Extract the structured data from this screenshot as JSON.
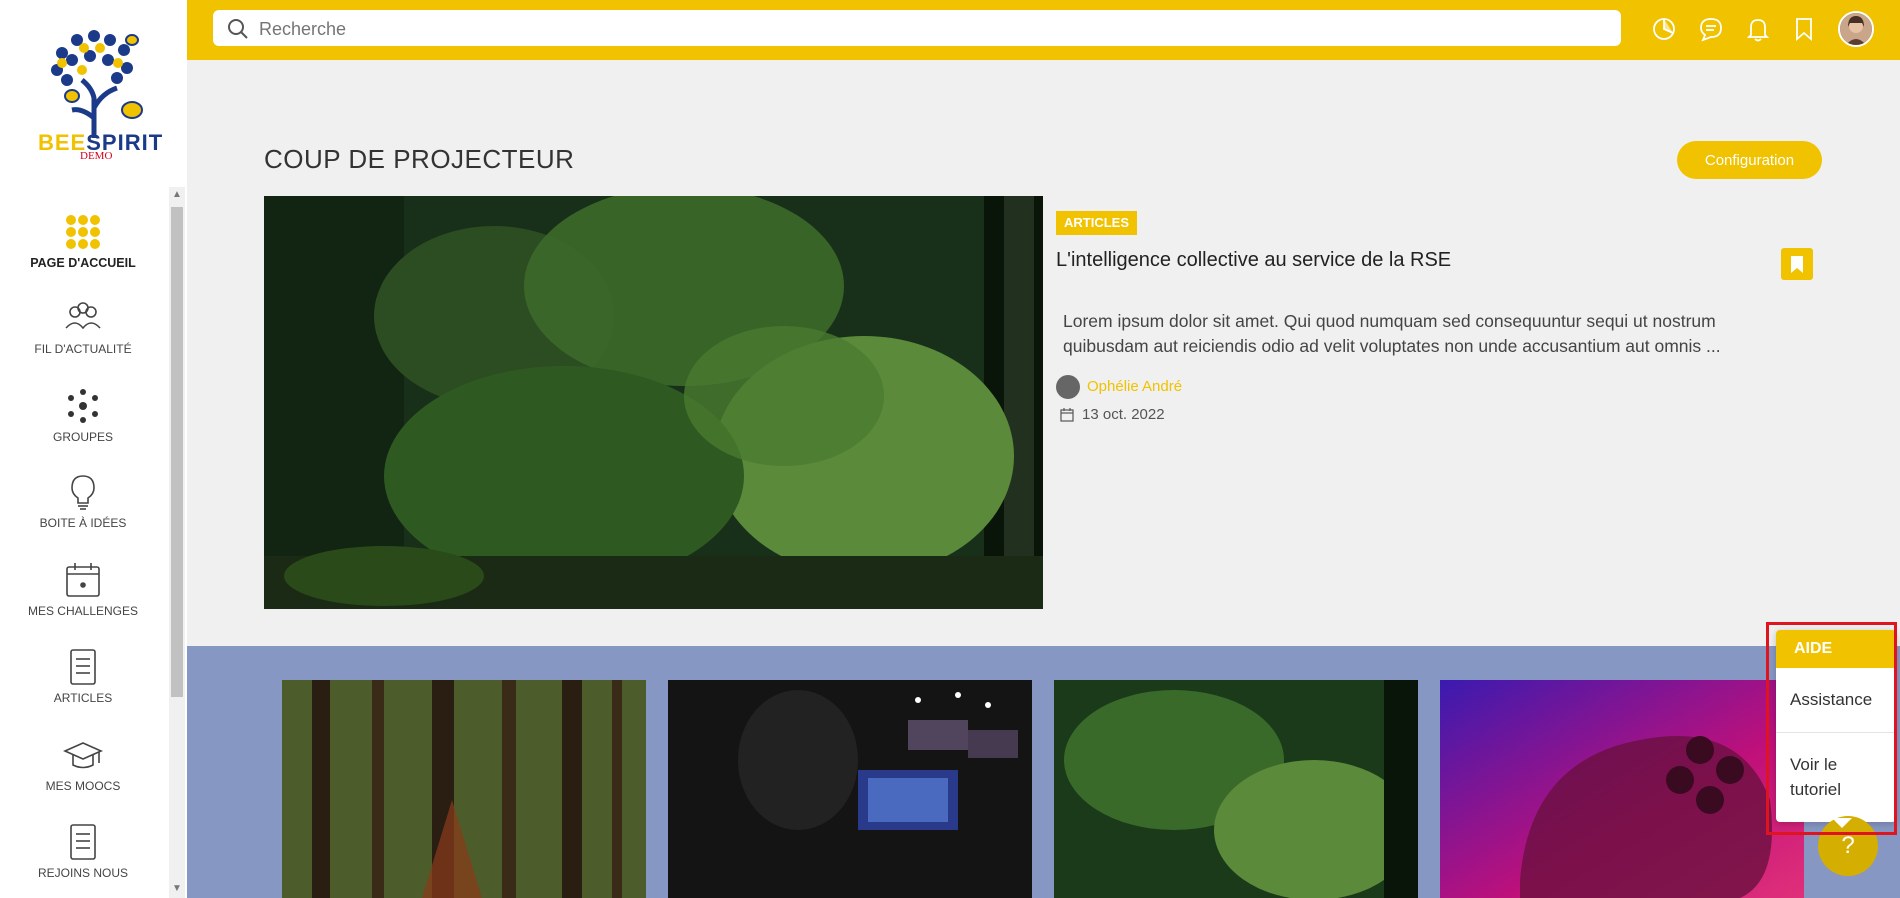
{
  "brand": {
    "name_part1": "BEE",
    "name_part2": "SPIRIT",
    "tag": "DEMO"
  },
  "sidebar": {
    "items": [
      {
        "label": "PAGE D'ACCUEIL",
        "icon": "grid-dots-icon",
        "active": true
      },
      {
        "label": "FIL D'ACTUALITÉ",
        "icon": "people-icon"
      },
      {
        "label": "GROUPES",
        "icon": "group-network-icon"
      },
      {
        "label": "BOITE À IDÉES",
        "icon": "lightbulb-icon"
      },
      {
        "label": "MES CHALLENGES",
        "icon": "calendar-icon"
      },
      {
        "label": "ARTICLES",
        "icon": "document-icon"
      },
      {
        "label": "MES MOOCS",
        "icon": "graduation-cap-icon"
      },
      {
        "label": "REJOINS NOUS",
        "icon": "document-icon"
      }
    ]
  },
  "topbar": {
    "search_placeholder": "Recherche",
    "icons": [
      "chart-pie-icon",
      "chat-icon",
      "bell-icon",
      "bookmark-icon",
      "user-avatar"
    ]
  },
  "spotlight": {
    "title": "COUP DE PROJECTEUR",
    "config_label": "Configuration",
    "article": {
      "badge": "ARTICLES",
      "title": "L'intelligence collective au service de la RSE",
      "excerpt": "Lorem ipsum dolor sit amet. Qui quod numquam sed consequuntur sequi ut nostrum quibusdam aut reiciendis odio ad velit voluptates non unde accusantium aut omnis ...",
      "author": "Ophélie André",
      "date": "13 oct. 2022"
    }
  },
  "help": {
    "title": "AIDE",
    "items": [
      "Assistance",
      "Voir le tutoriel"
    ],
    "fab_label": "?"
  },
  "colors": {
    "accent": "#f0c200",
    "band": "#8797c4"
  }
}
